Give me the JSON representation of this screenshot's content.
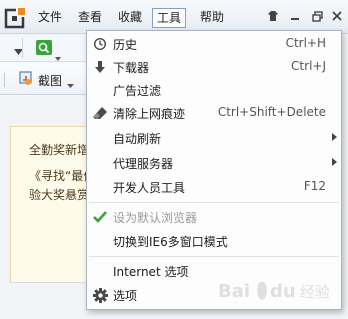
{
  "menubar": {
    "items": [
      {
        "label": "文件"
      },
      {
        "label": "查看"
      },
      {
        "label": "收藏"
      },
      {
        "label": "工具",
        "active": true
      },
      {
        "label": "帮助"
      }
    ]
  },
  "toolbar": {
    "screenshot_label": "截图"
  },
  "content": {
    "line1": "全勤奖新增",
    "line2": "《寻找“最佳",
    "line3": "验大奖悬赏"
  },
  "dropdown": {
    "items": [
      {
        "icon": "clock-icon",
        "label": "历史",
        "shortcut": "Ctrl+H"
      },
      {
        "icon": "download-arrow-icon",
        "label": "下载器",
        "shortcut": "Ctrl+J"
      },
      {
        "icon": "",
        "label": "广告过滤",
        "shortcut": ""
      },
      {
        "icon": "eraser-icon",
        "label": "清除上网痕迹",
        "shortcut": "Ctrl+Shift+Delete"
      },
      {
        "icon": "",
        "label": "自动刷新",
        "shortcut": "",
        "submenu": true
      },
      {
        "icon": "",
        "label": "代理服务器",
        "shortcut": "",
        "submenu": true
      },
      {
        "icon": "",
        "label": "开发人员工具",
        "shortcut": "F12"
      },
      {
        "icon": "checkmark-icon",
        "label": "设为默认浏览器",
        "shortcut": "",
        "disabled": true
      },
      {
        "icon": "",
        "label": "切换到IE6多窗口模式",
        "shortcut": ""
      },
      {
        "icon": "",
        "label": "Internet 选项",
        "shortcut": ""
      },
      {
        "icon": "gear-icon",
        "label": "选项",
        "shortcut": ""
      }
    ]
  },
  "watermark": {
    "text": "Bai du 经验"
  },
  "colors": {
    "menubar_bg": "#eaf0f6",
    "dropdown_bg": "#fdfdfd",
    "check_green": "#3aa33a",
    "logo_orange": "#f08a1c",
    "search_green": "#3aa33a"
  }
}
